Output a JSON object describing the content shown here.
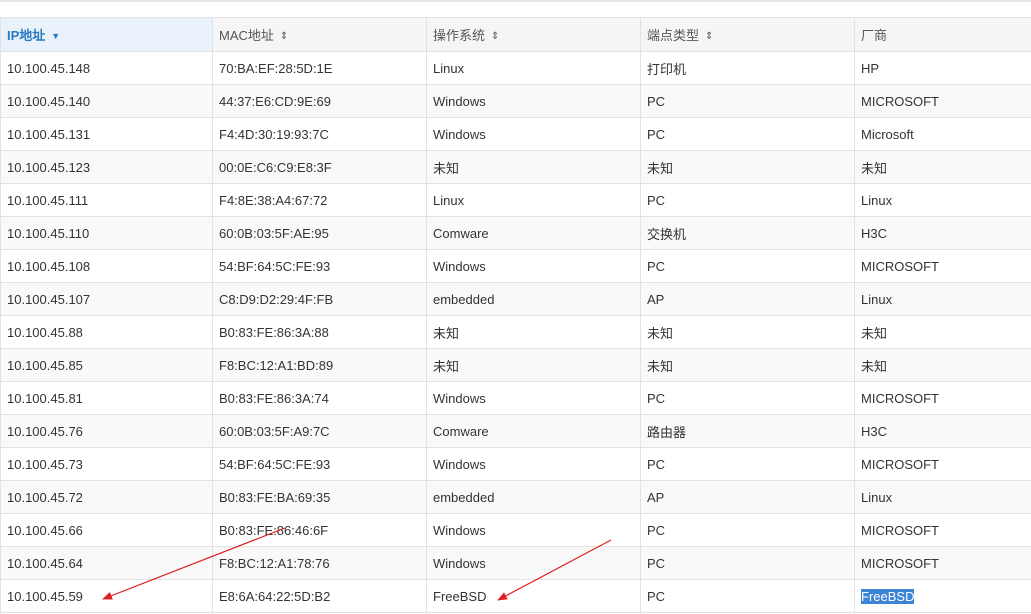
{
  "table": {
    "columns": [
      {
        "label": "IP地址",
        "sort_icon": "sort-down-icon",
        "sorted": true
      },
      {
        "label": "MAC地址",
        "sort_icon": "sort-both-icon",
        "sorted": false
      },
      {
        "label": "操作系统",
        "sort_icon": "sort-both-icon",
        "sorted": false
      },
      {
        "label": "端点类型",
        "sort_icon": "sort-both-icon",
        "sorted": false
      },
      {
        "label": "厂商",
        "sort_icon": "",
        "sorted": false
      }
    ],
    "rows": [
      [
        "10.100.45.148",
        "70:BA:EF:28:5D:1E",
        "Linux",
        "打印机",
        "HP"
      ],
      [
        "10.100.45.140",
        "44:37:E6:CD:9E:69",
        "Windows",
        "PC",
        "MICROSOFT"
      ],
      [
        "10.100.45.131",
        "F4:4D:30:19:93:7C",
        "Windows",
        "PC",
        "Microsoft"
      ],
      [
        "10.100.45.123",
        "00:0E:C6:C9:E8:3F",
        "未知",
        "未知",
        "未知"
      ],
      [
        "10.100.45.111",
        "F4:8E:38:A4:67:72",
        "Linux",
        "PC",
        "Linux"
      ],
      [
        "10.100.45.110",
        "60:0B:03:5F:AE:95",
        "Comware",
        "交换机",
        "H3C"
      ],
      [
        "10.100.45.108",
        "54:BF:64:5C:FE:93",
        "Windows",
        "PC",
        "MICROSOFT"
      ],
      [
        "10.100.45.107",
        "C8:D9:D2:29:4F:FB",
        "embedded",
        "AP",
        "Linux"
      ],
      [
        "10.100.45.88",
        "B0:83:FE:86:3A:88",
        "未知",
        "未知",
        "未知"
      ],
      [
        "10.100.45.85",
        "F8:BC:12:A1:BD:89",
        "未知",
        "未知",
        "未知"
      ],
      [
        "10.100.45.81",
        "B0:83:FE:86:3A:74",
        "Windows",
        "PC",
        "MICROSOFT"
      ],
      [
        "10.100.45.76",
        "60:0B:03:5F:A9:7C",
        "Comware",
        "路由器",
        "H3C"
      ],
      [
        "10.100.45.73",
        "54:BF:64:5C:FE:93",
        "Windows",
        "PC",
        "MICROSOFT"
      ],
      [
        "10.100.45.72",
        "B0:83:FE:BA:69:35",
        "embedded",
        "AP",
        "Linux"
      ],
      [
        "10.100.45.66",
        "B0:83:FE:86:46:6F",
        "Windows",
        "PC",
        "MICROSOFT"
      ],
      [
        "10.100.45.64",
        "F8:BC:12:A1:78:76",
        "Windows",
        "PC",
        "MICROSOFT"
      ],
      [
        "10.100.45.59",
        "E8:6A:64:22:5D:B2",
        "FreeBSD",
        "PC",
        "FreeBSD"
      ]
    ],
    "selected_cell": {
      "row": 16,
      "col": 4
    }
  },
  "colors": {
    "accent": "#2a7ac2",
    "selection": "#3c84d6",
    "annotation_arrow": "#e02020"
  }
}
